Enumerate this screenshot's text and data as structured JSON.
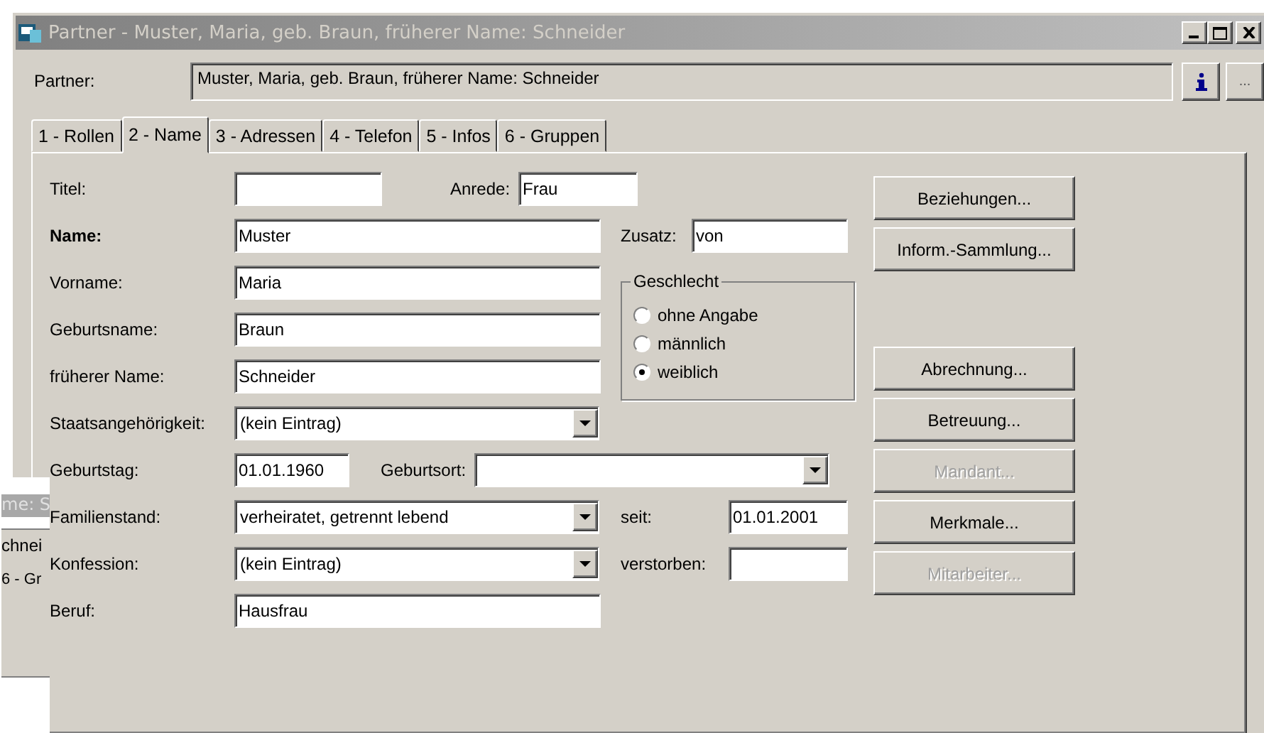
{
  "window": {
    "title": "Partner - Muster, Maria, geb. Braun, früherer Name: Schneider",
    "active": false
  },
  "partner": {
    "label": "Partner:",
    "value": "Muster, Maria, geb. Braun, früherer Name: Schneider",
    "more_button": "..."
  },
  "tabs": [
    {
      "label": "1 - Rollen",
      "selected": false
    },
    {
      "label": "2 - Name",
      "selected": true
    },
    {
      "label": "3 - Adressen",
      "selected": false
    },
    {
      "label": "4 - Telefon",
      "selected": false
    },
    {
      "label": "5 - Infos",
      "selected": false
    },
    {
      "label": "6 - Gruppen",
      "selected": false
    }
  ],
  "form": [
    {
      "label": "Titel:",
      "bold": false,
      "fields": [
        {
          "kind": "text"
        },
        {
          "kind": "text",
          "label": "Anrede:",
          "value": "Frau"
        }
      ]
    },
    {
      "label": "Name:",
      "bold": true,
      "fields": [
        {
          "kind": "text",
          "value": "Muster"
        }
      ]
    },
    {
      "label": "Vorname:",
      "bold": false,
      "fields": [
        {
          "kind": "text",
          "value": "Maria"
        }
      ]
    },
    {
      "label": "Geburtsname:",
      "bold": false,
      "fields": [
        {
          "kind": "text",
          "value": "Braun"
        }
      ]
    },
    {
      "label": "früherer Name:",
      "bold": false,
      "fields": [
        {
          "kind": "text",
          "value": "Schneider"
        }
      ]
    },
    {
      "label": "Staatsangehörigkeit:",
      "bold": false,
      "fields": [
        {
          "kind": "combo",
          "value": "(kein Eintrag)"
        }
      ]
    },
    {
      "label": "Geburtstag:",
      "bold": false,
      "fields": [
        {
          "kind": "text",
          "value": "01.01.1960"
        },
        {
          "kind": "combo",
          "label": "Geburtsort:"
        }
      ]
    },
    {
      "label": "Familienstand:",
      "bold": false,
      "fields": [
        {
          "kind": "combo",
          "value": "verheiratet, getrennt lebend"
        }
      ]
    },
    {
      "label": "Konfession:",
      "bold": false,
      "fields": [
        {
          "kind": "combo",
          "value": "(kein Eintrag)"
        }
      ]
    },
    {
      "label": "Beruf:",
      "bold": false,
      "fields": [
        {
          "kind": "text",
          "value": "Hausfrau"
        }
      ]
    }
  ],
  "side_fields": [
    {
      "label": "Zusatz:",
      "value": "von"
    },
    {
      "label": "seit:",
      "value": "01.01.2001"
    },
    {
      "label": "verstorben:"
    }
  ],
  "gender": {
    "title": "Geschlecht",
    "options": [
      {
        "label": "ohne Angabe",
        "selected": false
      },
      {
        "label": "männlich",
        "selected": false
      },
      {
        "label": "weiblich",
        "selected": true
      }
    ]
  },
  "buttons": [
    {
      "label": "Beziehungen...",
      "disabled": false
    },
    {
      "label": "Inform.-Sammlung...",
      "disabled": false
    },
    {
      "label": "Abrechnung...",
      "disabled": false
    },
    {
      "label": "Betreuung...",
      "disabled": false
    },
    {
      "label": "Mandant...",
      "disabled": true
    },
    {
      "label": "Merkmale...",
      "disabled": false
    },
    {
      "label": "Mitarbeiter...",
      "disabled": true
    }
  ],
  "background_window": {
    "title": "me: S",
    "field": "chnei",
    "tab": "6 - Gr"
  }
}
